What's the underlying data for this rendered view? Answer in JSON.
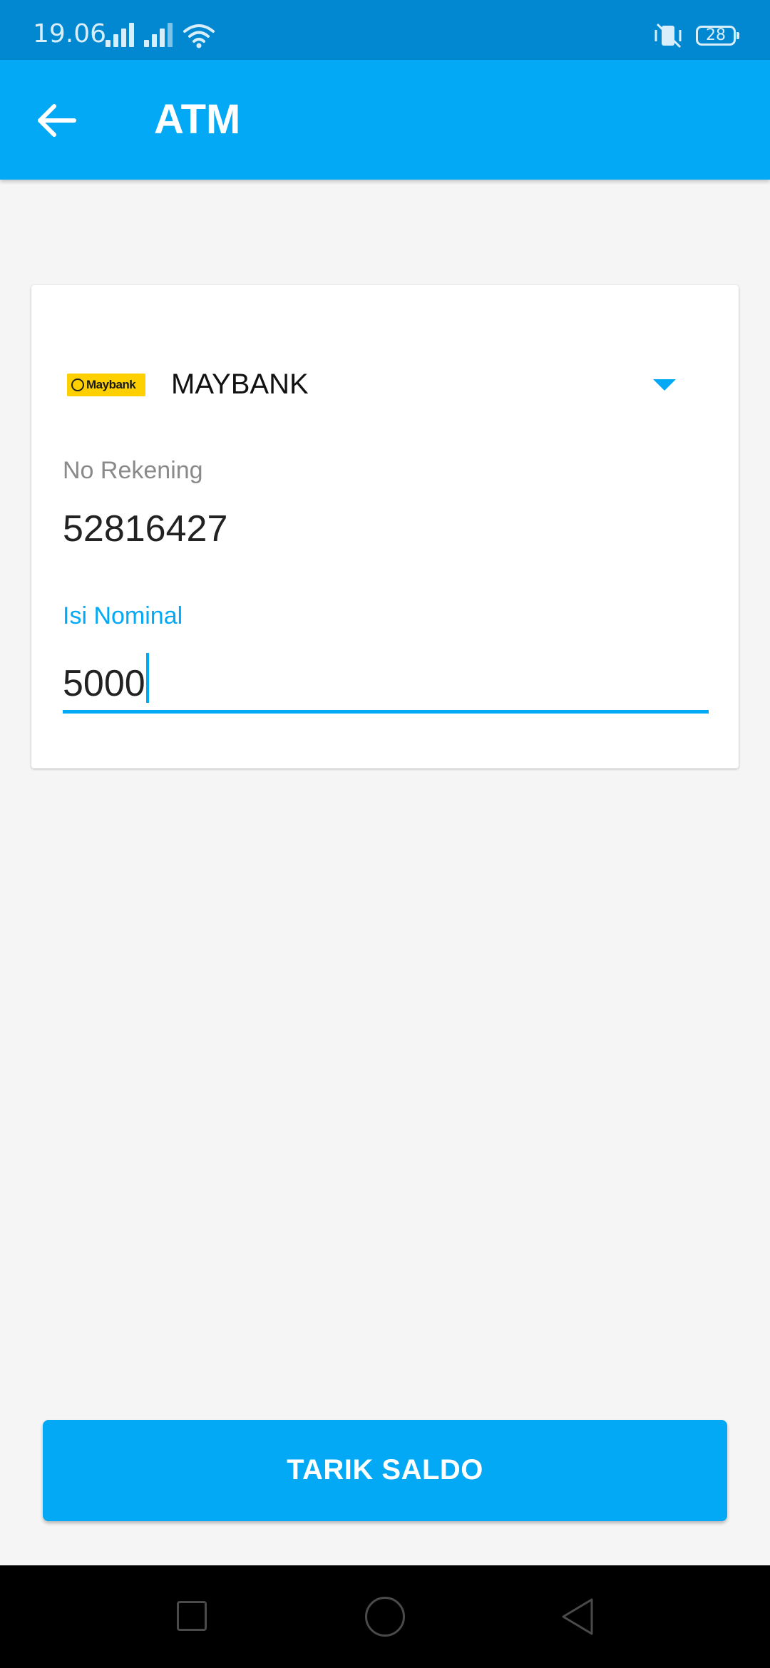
{
  "status_bar": {
    "time": "19.06",
    "battery": "28",
    "icons": [
      "signal-icon",
      "signal-icon",
      "wifi-icon",
      "vibrate-mute-icon",
      "battery-icon"
    ]
  },
  "app_bar": {
    "title": "ATM",
    "back_icon": "arrow-left-icon"
  },
  "form": {
    "bank": {
      "logo_text": "Maybank",
      "name": "MAYBANK",
      "dropdown_icon": "caret-down-icon"
    },
    "account": {
      "label": "No Rekening",
      "value": "52816427"
    },
    "amount": {
      "label": "Isi Nominal",
      "value": "5000"
    }
  },
  "actions": {
    "withdraw_label": "TARIK SALDO"
  },
  "nav_bar": {
    "icons": [
      "recents-square-icon",
      "home-circle-icon",
      "back-triangle-icon"
    ]
  },
  "colors": {
    "primary": "#03a9f4",
    "status_bar": "#0288d1",
    "background": "#f5f5f5",
    "bank_logo": "#ffd000"
  }
}
